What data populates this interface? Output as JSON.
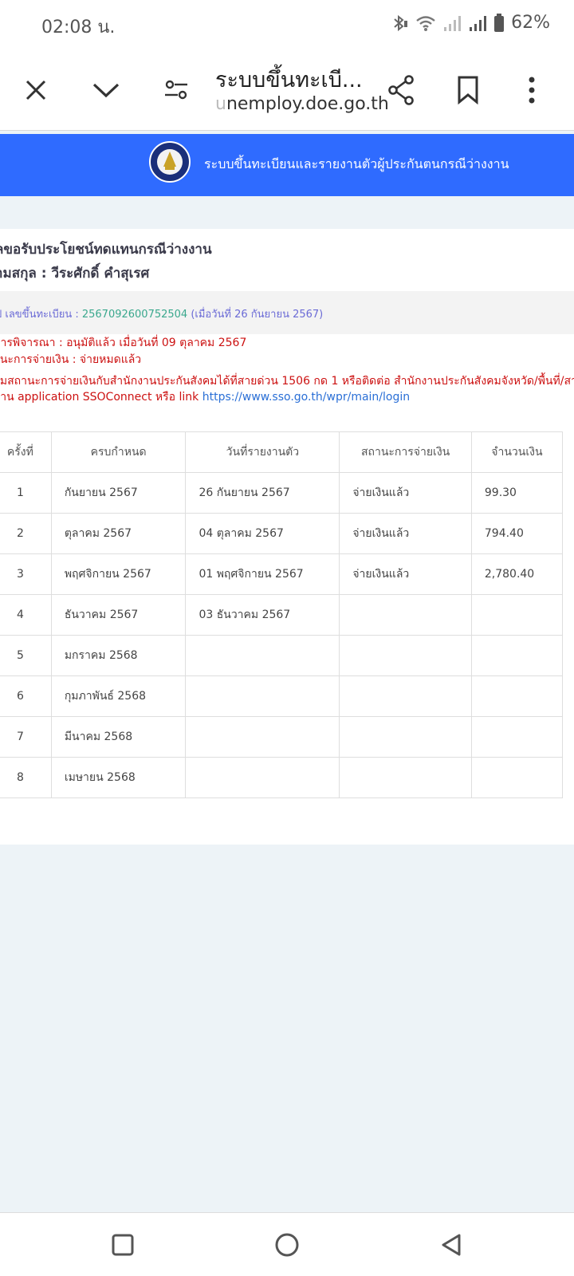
{
  "status_bar": {
    "time": "02:08 น.",
    "battery_percent": "62%",
    "icons": [
      "bluetooth-icon",
      "wifi-icon",
      "signal-icon",
      "signal-icon",
      "battery-icon"
    ]
  },
  "browser": {
    "page_title": "ระบบขึ้นทะเบี...",
    "url_prefix": "u",
    "url_main": "nemploy.doe.go.th",
    "icons": [
      "close-icon",
      "chevron-down-icon",
      "site-settings-icon",
      "share-icon",
      "bookmark-icon",
      "more-icon"
    ]
  },
  "header": {
    "site_title": "ระบบขึ้นทะเบียนและรายงานตัวผู้ประกันตนกรณีว่างงาน",
    "logo": "department-of-employment-logo",
    "accent_color": "#2f6bff"
  },
  "detail": {
    "heading": "ลขอรับประโยชน์ทดแทนกรณีว่างงาน",
    "name_line": "ามสกุล : วีระศักดิ์ คำสุเรศ",
    "reg_label": "ป เลขขึ้นทะเบียน : ",
    "reg_number": "2567092600752504",
    "reg_date": " (เมื่อวันที่ 26 กันยายน 2567)",
    "status_line": "การพิจารณา : อนุมัติแล้ว เมื่อวันที่ 09 ตุลาคม 2567",
    "payment_line": "านะการจ่ายเงิน : จ่ายหมดแล้ว",
    "note_line1": "ามสถานะการจ่ายเงินกับสำนักงานประกันสังคมได้ที่สายด่วน 1506 กด 1 หรือติดต่อ สำนักงานประกันสังคมจังหวัด/พื้นที่/สาขาใกล้บ้าน",
    "note_line2": "ผ่าน application SSOConnect หรือ link ",
    "note_link": "https://www.sso.go.th/wpr/main/login"
  },
  "table": {
    "headers": [
      "ครั้งที่",
      "ครบกำหนด",
      "วันที่รายงานตัว",
      "สถานะการจ่ายเงิน",
      "จำนวนเงิน"
    ],
    "rows": [
      {
        "no": "1",
        "due": "กันยายน 2567",
        "report": "26 กันยายน 2567",
        "status": "จ่ายเงินแล้ว",
        "amount": "99.30"
      },
      {
        "no": "2",
        "due": "ตุลาคม 2567",
        "report": "04 ตุลาคม 2567",
        "status": "จ่ายเงินแล้ว",
        "amount": "794.40"
      },
      {
        "no": "3",
        "due": "พฤศจิกายน 2567",
        "report": "01 พฤศจิกายน 2567",
        "status": "จ่ายเงินแล้ว",
        "amount": "2,780.40"
      },
      {
        "no": "4",
        "due": "ธันวาคม 2567",
        "report": "03 ธันวาคม 2567",
        "status": "",
        "amount": ""
      },
      {
        "no": "5",
        "due": "มกราคม 2568",
        "report": "",
        "status": "",
        "amount": ""
      },
      {
        "no": "6",
        "due": "กุมภาพันธ์ 2568",
        "report": "",
        "status": "",
        "amount": ""
      },
      {
        "no": "7",
        "due": "มีนาคม 2568",
        "report": "",
        "status": "",
        "amount": ""
      },
      {
        "no": "8",
        "due": "เมษายน 2568",
        "report": "",
        "status": "",
        "amount": ""
      }
    ]
  },
  "nav_bar": {
    "icons": [
      "recents-icon",
      "home-icon",
      "back-icon"
    ]
  }
}
